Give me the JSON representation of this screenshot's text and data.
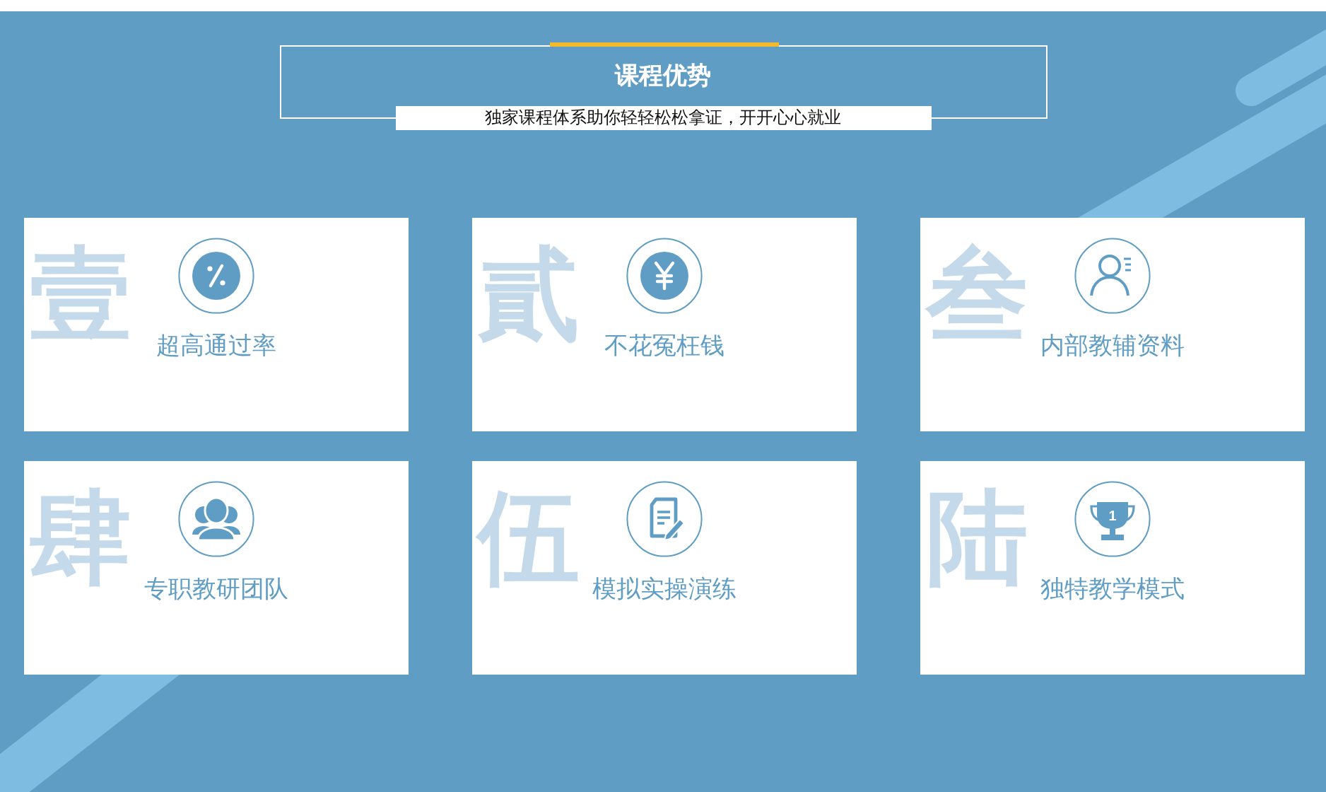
{
  "header": {
    "title": "课程优势",
    "subtitle": "独家课程体系助你轻轻松松拿证，开开心心就业"
  },
  "cards": [
    {
      "numeral": "壹",
      "kind": "percent",
      "label": "超高通过率"
    },
    {
      "numeral": "貳",
      "kind": "yen",
      "label": "不花冤枉钱"
    },
    {
      "numeral": "叁",
      "kind": "profile",
      "label": "内部教辅资料"
    },
    {
      "numeral": "肆",
      "kind": "group",
      "label": "专职教研团队"
    },
    {
      "numeral": "伍",
      "kind": "document",
      "label": "模拟实操演练"
    },
    {
      "numeral": "陆",
      "kind": "trophy",
      "label": "独特教学模式",
      "icon_text": "1"
    }
  ]
}
